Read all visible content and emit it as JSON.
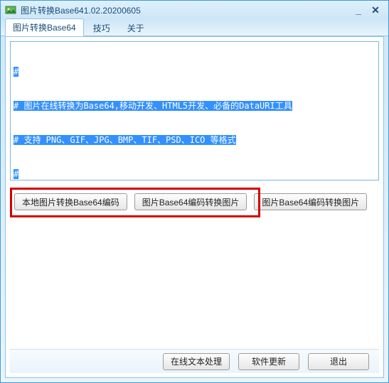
{
  "title": "图片转换Base641.02.20200605",
  "tabs": {
    "main": "图片转换Base64",
    "tips": "技巧",
    "about": "关于"
  },
  "textarea": {
    "line1": "#",
    "line2": "# 图片在线转换为Base64,移动开发、HTML5开发、必备的DataURI工具",
    "line3": "# 支持 PNG、GIF、JPG、BMP、TIF、PSD、ICO 等格式",
    "line4": "#"
  },
  "buttons": {
    "btn1": "本地图片转换Base64编码",
    "btn2": "图片Base64编码转换图片",
    "btn3": "图片Base64编码转换图片"
  },
  "bottom": {
    "online": "在线文本处理",
    "update": "软件更新",
    "exit": "退出"
  }
}
